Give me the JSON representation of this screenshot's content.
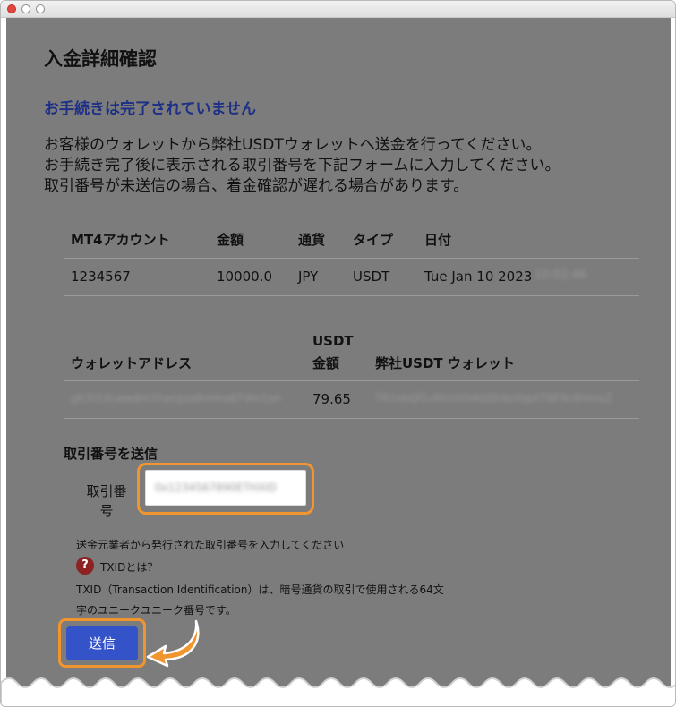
{
  "page": {
    "title": "入金詳細確認",
    "status": "お手続きは完了されていません",
    "instructions": [
      "お客様のウォレットから弊社USDTウォレットへ送金を行ってください。",
      "お手続き完了後に表示される取引番号を下記フォームに入力してください。",
      "取引番号が未送信の場合、着金確認が遅れる場合があります。"
    ]
  },
  "table1": {
    "headers": [
      "MT4アカウント",
      "金額",
      "通貨",
      "タイプ",
      "日付"
    ],
    "row": [
      "1234567",
      "10000.0",
      "JPY",
      "USDT",
      "Tue Jan 10 2023"
    ],
    "row_time_redacted": "10:02:46"
  },
  "table2": {
    "headers": [
      "ウォレットアドレス",
      "USDT",
      "金額",
      "弊社USDT ウォレット"
    ],
    "row": [
      "gK3t53Lwwdm1hanpza8nHnaEFWn1sn",
      "79.65",
      "TR1vbQf1vRhUVH4GDhbUGpXTNF9c9HmxZ"
    ]
  },
  "form": {
    "section_title": "取引番号を送信",
    "field_label": "取引番号",
    "field_value": "0x1234567890ETHXID",
    "help_text": "送金元業者から発行された取引番号を入力してください",
    "txid_link": "TXIDとは？",
    "qicon": "?",
    "txid_desc_line1": "TXID（Transaction Identification）は、暗号通貨の取引で使用される64文",
    "txid_desc_line2": "字のユニークユニーク番号です。",
    "submit_label": "送信"
  },
  "colors": {
    "overlay": "#7c7c7c",
    "status_text": "#1e2f86",
    "highlight": "#f1962f",
    "button": "#3553c9",
    "qicon": "#8c2222"
  },
  "icons": [
    "close-dot",
    "minimize-dot",
    "zoom-dot",
    "question-icon",
    "arrow-pointer-icon"
  ]
}
